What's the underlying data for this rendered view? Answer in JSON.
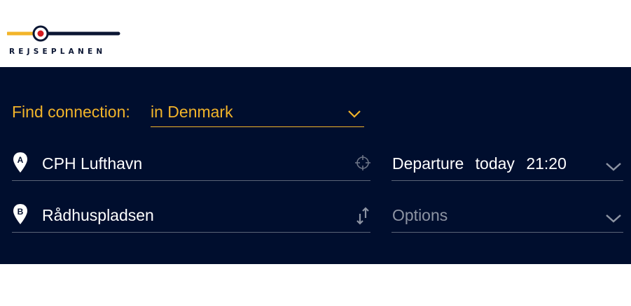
{
  "logo": {
    "text": "REJSEPLANEN"
  },
  "search": {
    "find_label": "Find connection:",
    "region_value": "in Denmark",
    "from": {
      "marker": "A",
      "value": "CPH Lufthavn"
    },
    "to": {
      "marker": "B",
      "value": "Rådhuspladsen"
    },
    "time": {
      "mode": "Departure",
      "day": "today",
      "clock": "21:20"
    },
    "options_placeholder": "Options"
  },
  "colors": {
    "navy_panel": "#000e2e",
    "accent_yellow": "#f2b42a",
    "logo_red": "#d41a1f",
    "logo_navy": "#0b1633",
    "muted_gray": "#8d94a3"
  },
  "icons": [
    "location-pin-a-icon",
    "location-pin-b-icon",
    "crosshair-locate-icon",
    "swap-arrows-icon",
    "chevron-down-icon"
  ]
}
